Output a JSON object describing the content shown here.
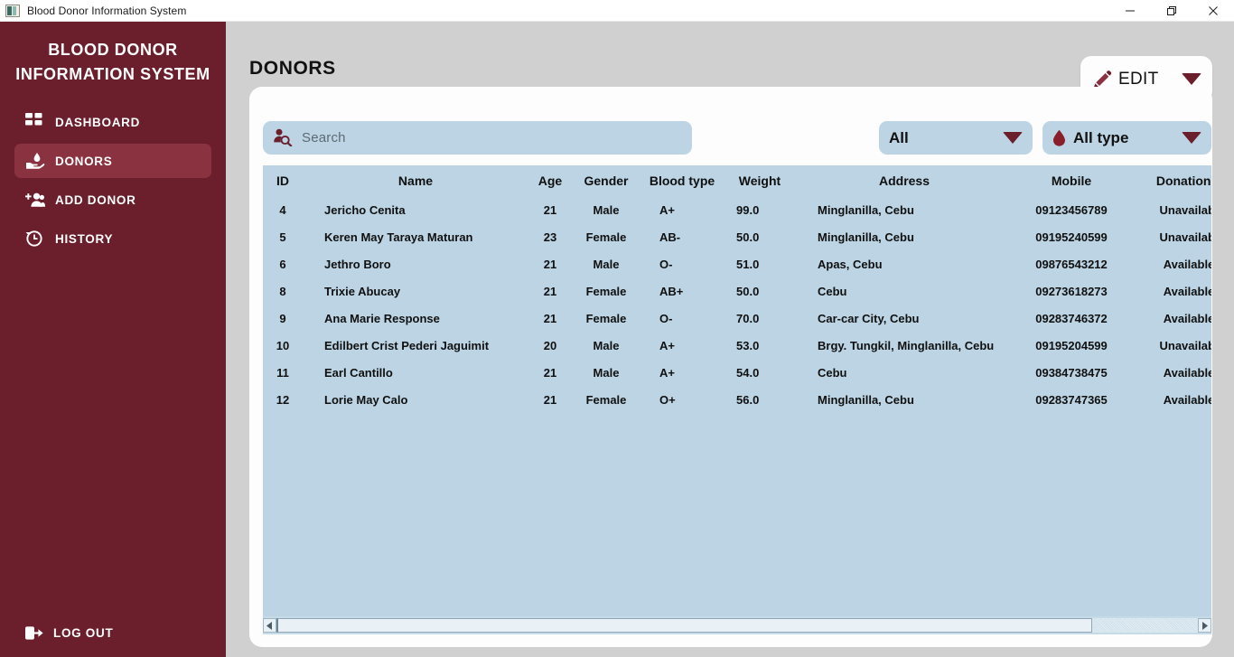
{
  "window": {
    "title": "Blood Donor Information System",
    "icon": "app-icon",
    "controls": {
      "minimize": "minimize-icon",
      "maximize": "maximize-icon",
      "close": "close-icon"
    }
  },
  "sidebar": {
    "brand_line1": "BLOOD DONOR",
    "brand_line2": "INFORMATION SYSTEM",
    "items": [
      {
        "label": "DASHBOARD",
        "icon": "dashboard-icon",
        "active": false
      },
      {
        "label": "DONORS",
        "icon": "donor-hand-icon",
        "active": true
      },
      {
        "label": "ADD DONOR",
        "icon": "add-person-icon",
        "active": false
      },
      {
        "label": "HISTORY",
        "icon": "clock-history-icon",
        "active": false
      }
    ],
    "logout": {
      "label": "LOG OUT",
      "icon": "logout-icon"
    }
  },
  "header": {
    "title": "DONORS",
    "edit_button": {
      "label": "EDIT",
      "icon": "pencil-icon",
      "caret": "chevron-down-icon"
    }
  },
  "toolbar": {
    "search": {
      "placeholder": "Search",
      "value": "",
      "icon": "person-search-icon"
    },
    "filter_status": {
      "selected": "All",
      "caret": "chevron-down-icon"
    },
    "filter_blood_type": {
      "selected": "All type",
      "icon": "blood-drop-icon",
      "caret": "chevron-down-icon"
    }
  },
  "table": {
    "columns": [
      "ID",
      "Name",
      "Age",
      "Gender",
      "Blood type",
      "Weight",
      "Address",
      "Mobile",
      "Donation s"
    ],
    "rows": [
      {
        "id": "4",
        "name": "Jericho  Cenita",
        "age": "21",
        "gender": "Male",
        "blood_type": "A+",
        "weight": "99.0",
        "address": "Minglanilla, Cebu",
        "mobile": "09123456789",
        "status": "Unavailabl"
      },
      {
        "id": "5",
        "name": "Keren May Taraya Maturan",
        "age": "23",
        "gender": "Female",
        "blood_type": "AB-",
        "weight": "50.0",
        "address": "Minglanilla, Cebu",
        "mobile": "09195240599",
        "status": "Unavailabl"
      },
      {
        "id": "6",
        "name": "Jethro  Boro",
        "age": "21",
        "gender": "Male",
        "blood_type": "O-",
        "weight": "51.0",
        "address": "Apas, Cebu",
        "mobile": "09876543212",
        "status": "Available"
      },
      {
        "id": "8",
        "name": "Trixie  Abucay",
        "age": "21",
        "gender": "Female",
        "blood_type": "AB+",
        "weight": "50.0",
        "address": "Cebu",
        "mobile": "09273618273",
        "status": "Available"
      },
      {
        "id": "9",
        "name": "Ana Marie  Response",
        "age": "21",
        "gender": "Female",
        "blood_type": "O-",
        "weight": "70.0",
        "address": "Car-car City, Cebu",
        "mobile": "09283746372",
        "status": "Available"
      },
      {
        "id": "10",
        "name": "Edilbert Crist Pederi Jaguimit",
        "age": "20",
        "gender": "Male",
        "blood_type": "A+",
        "weight": "53.0",
        "address": "Brgy. Tungkil, Minglanilla, Cebu",
        "mobile": "09195204599",
        "status": "Unavailabl"
      },
      {
        "id": "11",
        "name": "Earl  Cantillo",
        "age": "21",
        "gender": "Male",
        "blood_type": "A+",
        "weight": "54.0",
        "address": "Cebu",
        "mobile": "09384738475",
        "status": "Available"
      },
      {
        "id": "12",
        "name": "Lorie May  Calo",
        "age": "21",
        "gender": "Female",
        "blood_type": "O+",
        "weight": "56.0",
        "address": "Minglanilla, Cebu",
        "mobile": "09283747365",
        "status": "Available"
      }
    ]
  },
  "scrollbar": {
    "left_arrow": "scroll-left-icon",
    "right_arrow": "scroll-right-icon"
  },
  "colors": {
    "sidebar": "#6b1f2c",
    "sidebar_active": "#8a3240",
    "page_bg": "#d0d0d0",
    "card_bg": "#fdfdfd",
    "table_bg": "#bcd4e4",
    "accent": "#6b1f2c"
  }
}
